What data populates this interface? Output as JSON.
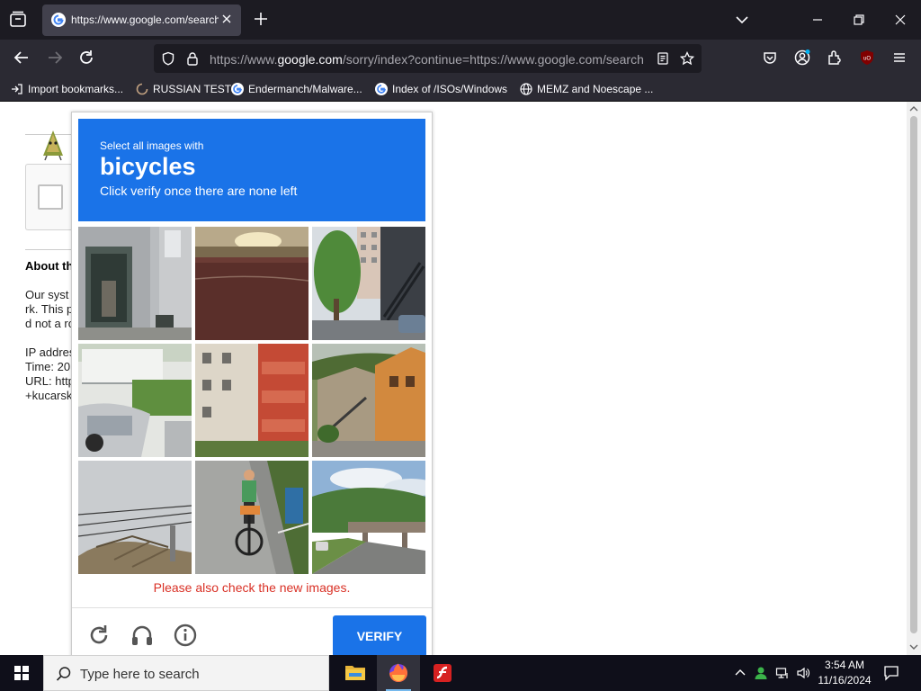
{
  "browser": {
    "tab": {
      "title": "https://www.google.com/search?q=..."
    },
    "url": {
      "prefix": "https://www.",
      "domain": "google.com",
      "rest": "/sorry/index?continue=https://www.google.com/search"
    },
    "bookmarks": [
      {
        "label": "Import bookmarks...",
        "icon": "import-icon"
      },
      {
        "label": "RUSSIAN TEST",
        "icon": "loading-icon"
      },
      {
        "label": "Endermanch/Malware...",
        "icon": "google-icon"
      },
      {
        "label": "Index of /ISOs/Windows",
        "icon": "google-icon"
      },
      {
        "label": "MEMZ and Noescape ...",
        "icon": "globe-icon"
      }
    ]
  },
  "page": {
    "about_title": "About th",
    "lines": [
      "Our syst",
      "rk. This p",
      "d not a ro",
      "IP addres",
      "Time: 20",
      "URL: http",
      "+kucarsk"
    ]
  },
  "captcha": {
    "prefix": "Select all images with",
    "target": "bicycles",
    "subtitle": "Click verify once there are none left",
    "error": "Please also check the new images.",
    "verify_label": "VERIFY",
    "tiles": [
      {
        "scene": "building doorway"
      },
      {
        "scene": "sunset wall"
      },
      {
        "scene": "apartment tree stairs"
      },
      {
        "scene": "balcony car"
      },
      {
        "scene": "red balconies"
      },
      {
        "scene": "houses hill stairs"
      },
      {
        "scene": "power lines roof"
      },
      {
        "scene": "cyclist"
      },
      {
        "scene": "road bridge"
      }
    ]
  },
  "taskbar": {
    "search_placeholder": "Type here to search",
    "time": "3:54 AM",
    "date": "11/16/2024"
  },
  "colors": {
    "captcha_blue": "#1a73e8",
    "error_red": "#d93025",
    "chrome_dark": "#1c1b22"
  }
}
